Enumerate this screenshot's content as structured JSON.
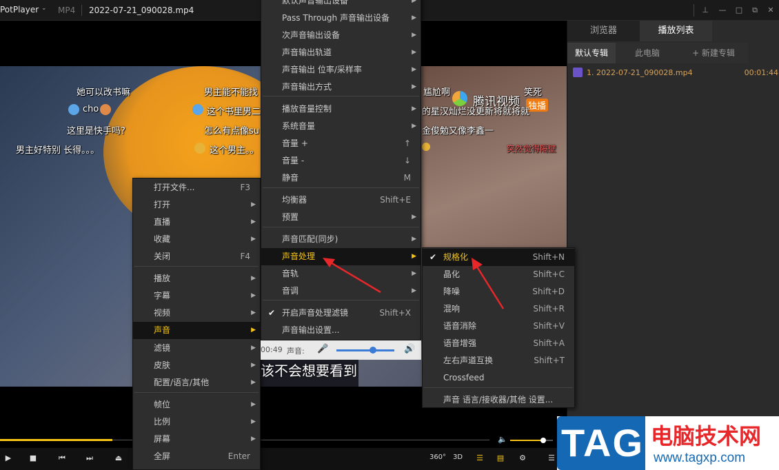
{
  "titlebar": {
    "app": "PotPlayer",
    "format": "MP4",
    "filename": "2022-07-21_090028.mp4"
  },
  "panel": {
    "tabs": [
      "浏览器",
      "播放列表"
    ],
    "subtabs": [
      "默认专辑",
      "此电脑",
      "+ 新建专辑"
    ],
    "item_name": "1. 2022-07-21_090028.mp4",
    "item_duration": "00:01:44"
  },
  "danmaku": [
    "她可以改书嘛",
    "男主能不能找",
    "cho",
    "这个书里男二",
    "这里是快手吗?",
    "怎么有点像su",
    "男主好特别 长得。。。",
    "这个男主。。",
    "尴尬啊",
    "笑死",
    "的星汉灿烂没更新将就将就",
    "金俊勉又像李鑫一",
    "突然觉得隔壁",
    "腾讯视频",
    "独播"
  ],
  "subtitle": "该不会想要看到",
  "main_menu": {
    "items": [
      {
        "label": "打开文件...",
        "shortcut": "F3"
      },
      {
        "label": "打开",
        "arrow": "▶"
      },
      {
        "label": "直播",
        "arrow": "▶"
      },
      {
        "label": "收藏",
        "arrow": "▶"
      },
      {
        "label": "关闭",
        "shortcut": "F4"
      },
      {
        "label": "播放",
        "arrow": "▶"
      },
      {
        "label": "字幕",
        "arrow": "▶"
      },
      {
        "label": "视频",
        "arrow": "▶"
      },
      {
        "label": "声音",
        "arrow": "▶"
      },
      {
        "label": "滤镜",
        "arrow": "▶"
      },
      {
        "label": "皮肤",
        "arrow": "▶"
      },
      {
        "label": "配置/语言/其他",
        "arrow": "▶"
      },
      {
        "label": "帧位",
        "arrow": "▶"
      },
      {
        "label": "比例",
        "arrow": "▶"
      },
      {
        "label": "屏幕",
        "arrow": "▶"
      },
      {
        "label": "全屏",
        "shortcut": "Enter"
      }
    ]
  },
  "sound_menu": {
    "items": [
      {
        "label": "默认声音输出设备",
        "arrow": "▶"
      },
      {
        "label": "Pass Through 声音输出设备",
        "arrow": "▶"
      },
      {
        "label": "次声音输出设备",
        "arrow": "▶"
      },
      {
        "label": "声音输出轨道",
        "arrow": "▶"
      },
      {
        "label": "声音输出 位率/采样率",
        "arrow": "▶"
      },
      {
        "label": "声音输出方式",
        "arrow": "▶"
      },
      {
        "label": "播放音量控制",
        "arrow": "▶"
      },
      {
        "label": "系统音量",
        "arrow": "▶"
      },
      {
        "label": "音量 +",
        "shortcut": "↑"
      },
      {
        "label": "音量 -",
        "shortcut": "↓"
      },
      {
        "label": "静音",
        "shortcut": "M"
      },
      {
        "label": "均衡器",
        "shortcut": "Shift+E"
      },
      {
        "label": "预置",
        "arrow": "▶"
      },
      {
        "label": "声音匹配(同步)",
        "arrow": "▶"
      },
      {
        "label": "声音处理",
        "arrow": "▶"
      },
      {
        "label": "音轨",
        "arrow": "▶"
      },
      {
        "label": "音调",
        "arrow": "▶"
      },
      {
        "label": "开启声音处理滤镜",
        "shortcut": "Shift+X",
        "check": "✔"
      },
      {
        "label": "声音输出设置..."
      }
    ],
    "volume_time": "00:49",
    "volume_label": "声音:"
  },
  "process_menu": {
    "items": [
      {
        "label": "规格化",
        "shortcut": "Shift+N",
        "check": "✔"
      },
      {
        "label": "晶化",
        "shortcut": "Shift+C"
      },
      {
        "label": "降噪",
        "shortcut": "Shift+D"
      },
      {
        "label": "混响",
        "shortcut": "Shift+R"
      },
      {
        "label": "语音消除",
        "shortcut": "Shift+V"
      },
      {
        "label": "语音增强",
        "shortcut": "Shift+A"
      },
      {
        "label": "左右声道互换",
        "shortcut": "Shift+T"
      },
      {
        "label": "Crossfeed"
      },
      {
        "label": "声音 语言/接收器/其他 设置..."
      }
    ]
  },
  "controls": {
    "b360": "360°",
    "b3d": "3D"
  },
  "watermark": {
    "logo": "TAG",
    "title": "电脑技术网",
    "url": "www.tagxp.com"
  },
  "progress": {
    "played_fraction": 0.23,
    "volume_fraction": 0.78
  }
}
